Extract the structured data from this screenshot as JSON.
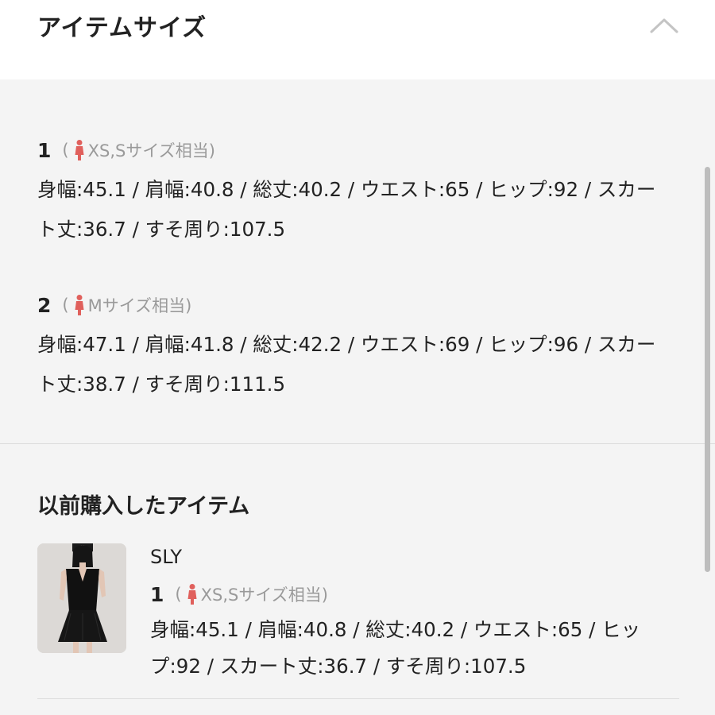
{
  "header": {
    "title": "アイテムサイズ",
    "collapse_icon": "chevron-up-icon"
  },
  "sizes": [
    {
      "number": "1",
      "paren_open": "(",
      "label": "XS,Sサイズ相当)",
      "measurements": "身幅:45.1 / 肩幅:40.8 / 総丈:40.2 / ウエスト:65 / ヒップ:92 / スカート丈:36.7 / すそ周り:107.5"
    },
    {
      "number": "2",
      "paren_open": "(",
      "label": "Mサイズ相当)",
      "measurements": "身幅:47.1 / 肩幅:41.8 / 総丈:42.2 / ウエスト:69 / ヒップ:96 / スカート丈:38.7 / すそ周り:111.5"
    }
  ],
  "previous_purchase": {
    "title": "以前購入したアイテム",
    "brand": "SLY",
    "size_number": "1",
    "paren_open": "(",
    "size_label": "XS,Sサイズ相当)",
    "measurements": "身幅:45.1 / 肩幅:40.8 / 総丈:40.2 / ウエスト:65 / ヒップ:92 / スカート丈:36.7 / すそ周り:107.5"
  },
  "colors": {
    "person_icon": "#e0605c",
    "muted_text": "#9a9a9a"
  }
}
